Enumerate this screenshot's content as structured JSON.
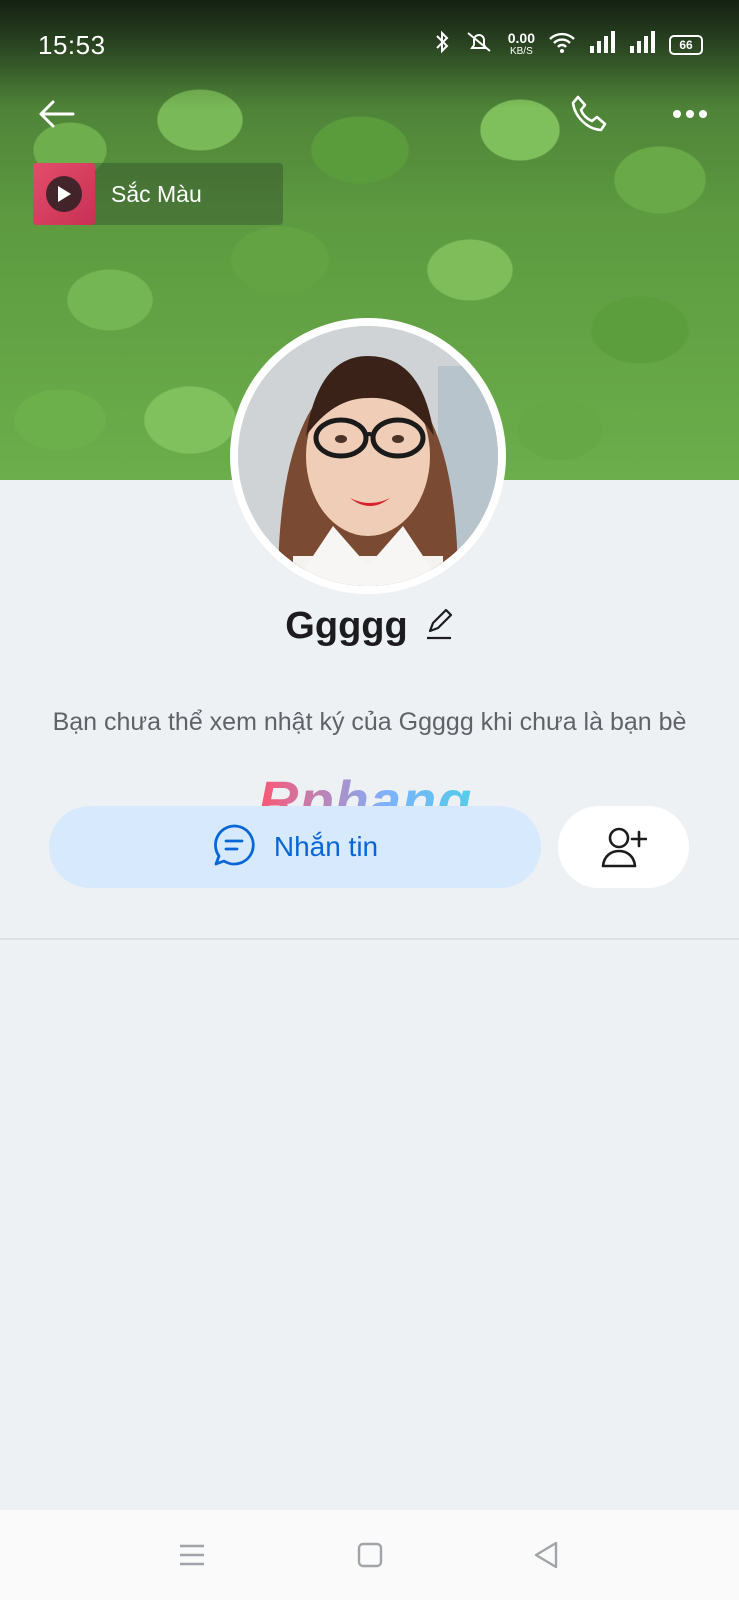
{
  "status_bar": {
    "time": "15:53",
    "network_speed_value": "0.00",
    "network_speed_unit": "KB/S",
    "battery": "66",
    "icons": [
      "bluetooth-icon",
      "mute-icon",
      "wifi-icon",
      "signal-icon",
      "signal-icon",
      "battery-icon"
    ]
  },
  "header": {
    "back_icon": "arrow-left-icon",
    "call_icon": "phone-icon",
    "more_icon": "more-dots-icon"
  },
  "music": {
    "title": "Sắc Màu",
    "icon": "play-icon"
  },
  "profile": {
    "name": "Ggggg",
    "edit_icon": "pencil-icon",
    "info": "Bạn chưa thể xem nhật ký của Ggggg khi chưa là bạn bè"
  },
  "watermark": "Rphang",
  "actions": {
    "message_label": "Nhắn tin",
    "message_icon": "chat-bubble-icon",
    "add_friend_icon": "add-user-icon"
  },
  "colors": {
    "accent": "#0866d6",
    "message_button_bg": "#d6e9fd",
    "page_bg": "#eef1f4"
  },
  "nav_bar": {
    "icons": [
      "menu-icon",
      "home-icon",
      "back-icon"
    ]
  }
}
